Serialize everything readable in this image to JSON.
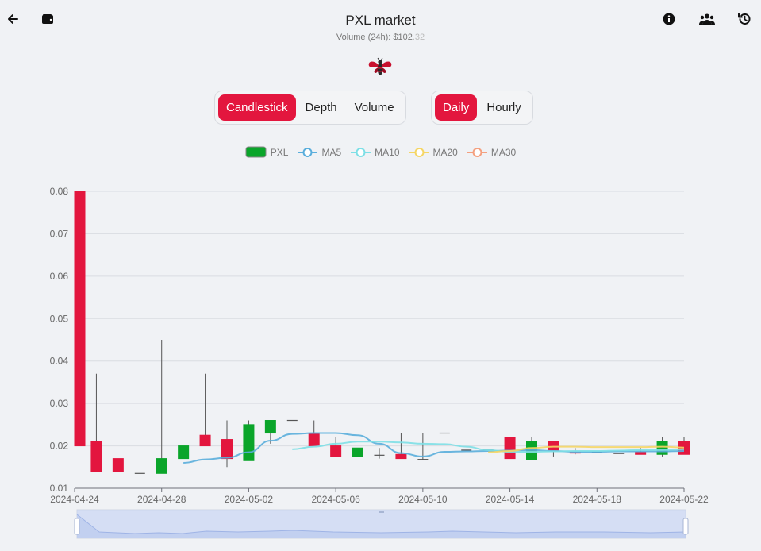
{
  "header": {
    "title": "PXL market",
    "volume_label": "Volume (24h): $102",
    "volume_decimals": ".32"
  },
  "tabs_chart": [
    {
      "label": "Candlestick",
      "active": true
    },
    {
      "label": "Depth",
      "active": false
    },
    {
      "label": "Volume",
      "active": false
    }
  ],
  "tabs_interval": [
    {
      "label": "Daily",
      "active": true
    },
    {
      "label": "Hourly",
      "active": false
    }
  ],
  "toolbar": {
    "back_icon": "arrow-left-icon",
    "wallet_icon": "wallet-icon",
    "info_icon": "info-icon",
    "users_icon": "users-icon",
    "history_icon": "history-icon"
  },
  "colors": {
    "accent": "#e3163e",
    "up": "#0aa52a",
    "down": "#e3163e",
    "ma5": "#5aaedc",
    "ma10": "#7ddfe6",
    "ma20": "#f5d665",
    "ma30": "#f4a07f"
  },
  "chart_data": {
    "type": "candlestick",
    "ylim": [
      0.01,
      0.08
    ],
    "y_ticks": [
      "0.08",
      "0.07",
      "0.06",
      "0.05",
      "0.04",
      "0.03",
      "0.02",
      "0.01"
    ],
    "x_ticks": [
      "2024-04-24",
      "2024-04-28",
      "2024-05-02",
      "2024-05-06",
      "2024-05-10",
      "2024-05-14",
      "2024-05-18",
      "2024-05-22"
    ],
    "legend": [
      "PXL",
      "MA5",
      "MA10",
      "MA20",
      "MA30"
    ],
    "dates": [
      "2024-04-24",
      "2024-04-25",
      "2024-04-26",
      "2024-04-27",
      "2024-04-28",
      "2024-04-29",
      "2024-04-30",
      "2024-05-01",
      "2024-05-02",
      "2024-05-03",
      "2024-05-04",
      "2024-05-05",
      "2024-05-06",
      "2024-05-07",
      "2024-05-08",
      "2024-05-09",
      "2024-05-10",
      "2024-05-11",
      "2024-05-12",
      "2024-05-13",
      "2024-05-14",
      "2024-05-15",
      "2024-05-16",
      "2024-05-17",
      "2024-05-18",
      "2024-05-19",
      "2024-05-20",
      "2024-05-21",
      "2024-05-22"
    ],
    "candles": [
      {
        "o": 0.08,
        "c": 0.02,
        "h": 0.08,
        "l": 0.02
      },
      {
        "o": 0.021,
        "c": 0.014,
        "h": 0.037,
        "l": 0.014
      },
      {
        "o": 0.017,
        "c": 0.014,
        "h": 0.017,
        "l": 0.014
      },
      {
        "o": 0.0135,
        "c": 0.0135,
        "h": 0.0135,
        "l": 0.0135
      },
      {
        "o": 0.0135,
        "c": 0.017,
        "h": 0.045,
        "l": 0.0135
      },
      {
        "o": 0.017,
        "c": 0.02,
        "h": 0.02,
        "l": 0.017
      },
      {
        "o": 0.0225,
        "c": 0.02,
        "h": 0.037,
        "l": 0.02
      },
      {
        "o": 0.0215,
        "c": 0.017,
        "h": 0.026,
        "l": 0.015
      },
      {
        "o": 0.0165,
        "c": 0.025,
        "h": 0.026,
        "l": 0.0165
      },
      {
        "o": 0.023,
        "c": 0.026,
        "h": 0.026,
        "l": 0.0205
      },
      {
        "o": 0.026,
        "c": 0.026,
        "h": 0.026,
        "l": 0.026
      },
      {
        "o": 0.023,
        "c": 0.02,
        "h": 0.026,
        "l": 0.02
      },
      {
        "o": 0.02,
        "c": 0.0175,
        "h": 0.022,
        "l": 0.0175
      },
      {
        "o": 0.0175,
        "c": 0.0195,
        "h": 0.0195,
        "l": 0.0175
      },
      {
        "o": 0.0178,
        "c": 0.0178,
        "h": 0.0195,
        "l": 0.017
      },
      {
        "o": 0.018,
        "c": 0.017,
        "h": 0.023,
        "l": 0.017
      },
      {
        "o": 0.0168,
        "c": 0.0168,
        "h": 0.023,
        "l": 0.0168
      },
      {
        "o": 0.023,
        "c": 0.023,
        "h": 0.023,
        "l": 0.023
      },
      {
        "o": 0.019,
        "c": 0.019,
        "h": 0.019,
        "l": 0.019
      },
      {
        "o": 0.019,
        "c": 0.019,
        "h": 0.019,
        "l": 0.019
      },
      {
        "o": 0.022,
        "c": 0.017,
        "h": 0.022,
        "l": 0.017
      },
      {
        "o": 0.0168,
        "c": 0.021,
        "h": 0.022,
        "l": 0.0168
      },
      {
        "o": 0.021,
        "c": 0.019,
        "h": 0.021,
        "l": 0.0175
      },
      {
        "o": 0.0185,
        "c": 0.0183,
        "h": 0.0195,
        "l": 0.018
      },
      {
        "o": 0.0185,
        "c": 0.0185,
        "h": 0.0185,
        "l": 0.0185
      },
      {
        "o": 0.0182,
        "c": 0.0182,
        "h": 0.0182,
        "l": 0.0182
      },
      {
        "o": 0.0185,
        "c": 0.018,
        "h": 0.0195,
        "l": 0.018
      },
      {
        "o": 0.018,
        "c": 0.021,
        "h": 0.022,
        "l": 0.0175
      },
      {
        "o": 0.021,
        "c": 0.018,
        "h": 0.022,
        "l": 0.018
      }
    ],
    "series": [
      {
        "name": "MA5",
        "start": 5,
        "values": [
          0.016,
          0.0168,
          0.0172,
          0.0185,
          0.0212,
          0.0228,
          0.023,
          0.023,
          0.0225,
          0.0205,
          0.0183,
          0.0175,
          0.0186,
          0.0187,
          0.0188,
          0.0189,
          0.019,
          0.0188,
          0.0186,
          0.0186,
          0.0187,
          0.0187,
          0.0187,
          0.0188
        ]
      },
      {
        "name": "MA10",
        "start": 10,
        "values": [
          0.0192,
          0.0198,
          0.0205,
          0.021,
          0.021,
          0.0208,
          0.0205,
          0.0204,
          0.0198,
          0.019,
          0.0186,
          0.0186,
          0.0187,
          0.0188,
          0.0188,
          0.0189,
          0.019,
          0.019,
          0.0192
        ]
      },
      {
        "name": "MA20",
        "start": 19,
        "values": [
          0.0185,
          0.0188,
          0.0195,
          0.0198,
          0.0198,
          0.0197,
          0.0197,
          0.0197,
          0.0198,
          0.0196
        ]
      },
      {
        "name": "MA30",
        "start": 28,
        "values": [
          0.0195
        ]
      }
    ]
  }
}
